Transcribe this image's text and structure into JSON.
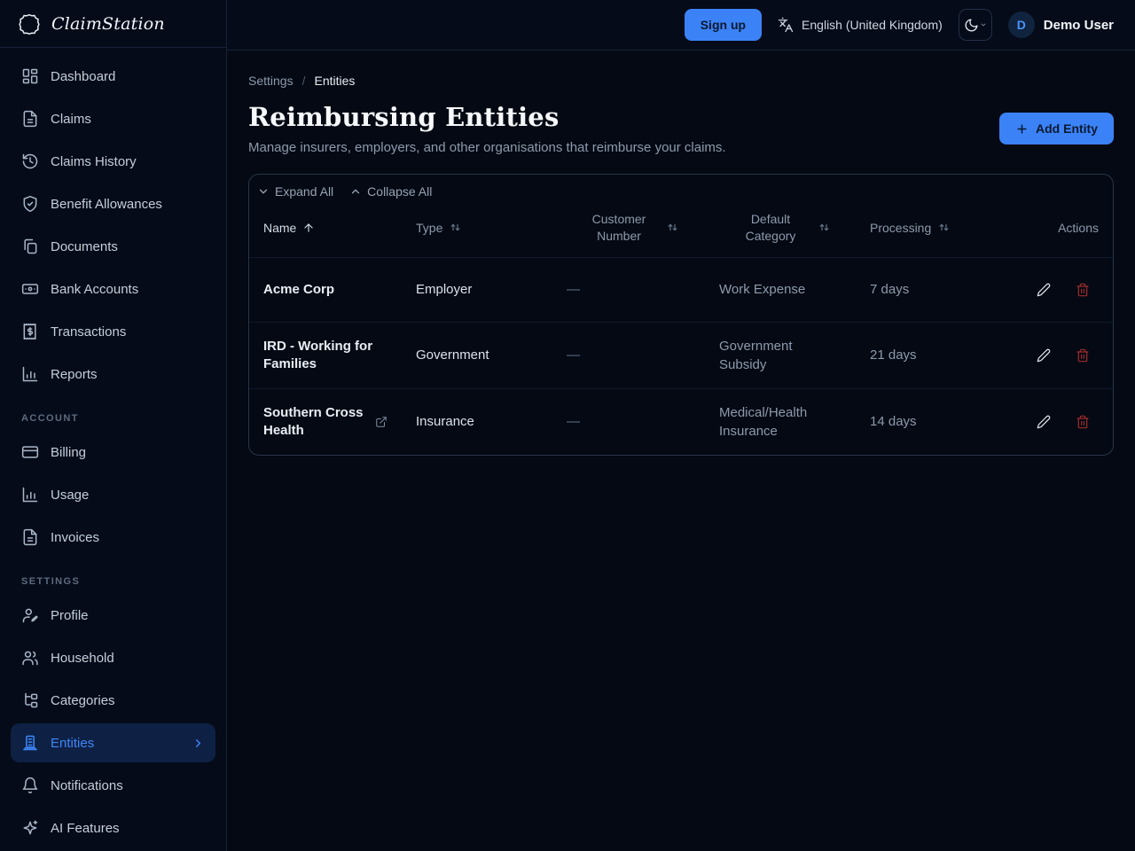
{
  "app": {
    "brand": "ClaimStation"
  },
  "topbar": {
    "signup_label": "Sign up",
    "language_label": "English (United Kingdom)",
    "user_initial": "D",
    "user_name": "Demo User"
  },
  "sidebar": {
    "items": [
      {
        "label": "Dashboard"
      },
      {
        "label": "Claims"
      },
      {
        "label": "Claims History"
      },
      {
        "label": "Benefit Allowances"
      },
      {
        "label": "Documents"
      },
      {
        "label": "Bank Accounts"
      },
      {
        "label": "Transactions"
      },
      {
        "label": "Reports"
      }
    ],
    "account_heading": "Account",
    "account_items": [
      {
        "label": "Billing"
      },
      {
        "label": "Usage"
      },
      {
        "label": "Invoices"
      }
    ],
    "settings_heading": "Settings",
    "settings_items": [
      {
        "label": "Profile"
      },
      {
        "label": "Household"
      },
      {
        "label": "Categories"
      },
      {
        "label": "Entities",
        "active": true
      },
      {
        "label": "Notifications"
      },
      {
        "label": "AI Features"
      }
    ]
  },
  "breadcrumb": {
    "parent": "Settings",
    "separator": "/",
    "current": "Entities"
  },
  "page": {
    "title": "Reimbursing Entities",
    "subtitle": "Manage insurers, employers, and other organisations that reimburse your claims.",
    "add_entity_label": "Add Entity"
  },
  "toolbar": {
    "expand_all": "Expand All",
    "collapse_all": "Collapse All"
  },
  "table": {
    "headers": {
      "name": "Name",
      "type": "Type",
      "customer_number": "Customer Number",
      "default_category": "Default Category",
      "processing": "Processing",
      "actions": "Actions"
    },
    "rows": [
      {
        "name": "Acme Corp",
        "type": "Employer",
        "customer_number": "—",
        "default_category": "Work Expense",
        "processing": "7 days"
      },
      {
        "name": "IRD - Working for Families",
        "type": "Government",
        "customer_number": "—",
        "default_category": "Government Subsidy",
        "processing": "21 days"
      },
      {
        "name": "Southern Cross Health",
        "type": "Insurance",
        "customer_number": "—",
        "default_category": "Medical/Health Insurance",
        "processing": "14 days"
      }
    ]
  },
  "colors": {
    "accent": "#3b82f6",
    "danger": "#a02c2c",
    "background": "#040913"
  }
}
